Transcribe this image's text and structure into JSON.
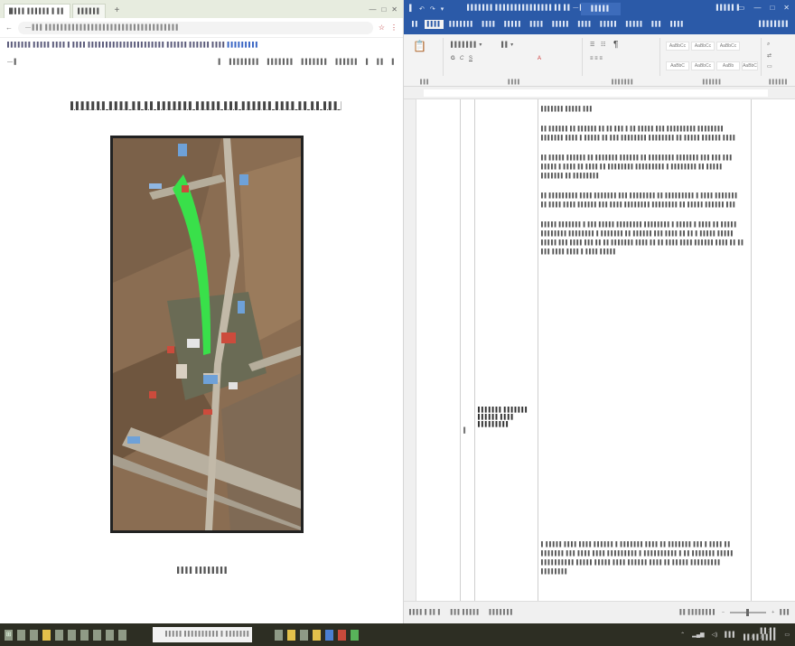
{
  "browser": {
    "tabs": [
      {
        "label": "█ ▌▌▌ ▌▌▌▌▌▌ ▌ ▌▌"
      },
      {
        "label": "▌▌▌▌▌▌"
      }
    ],
    "new_tab": "+",
    "controls": [
      "—",
      "□",
      "✕"
    ],
    "address": "— ▌▌▌ ▌▌▌▌▌▌▌▌▌▌▌▌▌▌▌▌▌▌▌▌▌▌▌▌▌▌▌▌▌▌▌▌▌▌▌",
    "notice": "▌▌▌▌▌▌▌ ▌▌▌▌▌ ▌▌▌▌ ▌ ▌▌▌▌ ▌▌▌▌▌▌▌▌▌▌▌▌▌▌▌▌▌▌▌▌▌▌ ▌▌▌▌▌▌ ▌▌▌▌▌▌ ▌▌▌▌",
    "notice_link": "▌▌▌▌▌▌▌▌▌",
    "pdf_left": "—  ▌",
    "pdf_right": [
      "▌",
      "▌▌▌▌▌▌▌▌",
      "▌▌▌▌▌▌▌",
      "▌▌▌▌▌▌▌",
      "▌▌▌▌▌▌",
      "▌",
      "▌▌",
      "▌"
    ]
  },
  "doc": {
    "caption_top": "▌▌▌▌▌▌▌ ▌▌▌▌ ▌▌ ▌▌ ▌▌▌▌▌▌▌ ▌▌▌▌▌ ▌▌▌ ▌▌▌▌▌▌ ▌▌▌▌ ▌▌ ▌▌ ▌▌▌ ▌▌▌▌ ▌▌▌▌▌▌▌▌",
    "caption_bottom": "▌▌▌▌ ▌▌▌▌▌▌▌▌"
  },
  "word": {
    "qat": [
      "▌",
      "↶",
      "↷",
      "▾"
    ],
    "doc_title": "▌▌▌▌▌▌▌ ▌▌▌▌▌▌▌▌▌▌▌▌▌▌▌ ▌▌ ▌▌  —  ▌▌▌",
    "title_tab": "▌▌▌▌▌",
    "user": "▌▌▌▌▌ ▌",
    "win_controls": [
      "▭",
      "—",
      "□",
      "✕"
    ],
    "ribbon_tabs": [
      "▌▌",
      "▌▌▌▌",
      "▌▌▌▌▌▌▌",
      "▌▌▌▌",
      "▌▌▌▌▌",
      "▌▌▌▌",
      "▌▌▌▌▌",
      "▌▌▌▌",
      "▌▌▌▌▌",
      "▌▌▌▌▌",
      "▌▌▌",
      "▌▌▌▌"
    ],
    "share": "▌▌▌▌▌▌▌▌",
    "ribbon_groups": [
      "▌▌▌",
      "▌▌▌▌",
      "▌▌▌▌▌▌▌",
      "▌▌▌▌▌▌",
      "▌▌▌▌▌▌"
    ],
    "styles": [
      "AaBbCc",
      "AaBbCc",
      "AaBbCc",
      "AaBbC",
      "AaBbCc",
      "AaBb",
      "AaBbC"
    ],
    "table_label": "▌▌▌▌▌▌▌ ▌▌▌▌▌▌▌ ▌▌▌▌▌▌ ▌▌▌▌ ▌▌▌▌▌▌▌▌▌",
    "table_row_marker": "▌",
    "paragraphs": [
      "▌▌▌▌▌▌▌ ▌▌▌▌▌ ▌▌▌",
      "▌▌ ▌▌▌▌▌▌ ▌▌ ▌▌▌▌▌▌ ▌▌ ▌▌ ▌▌▌ ▌ ▌▌ ▌▌▌▌▌ ▌▌▌ ▌▌▌▌▌▌▌▌▌ ▌▌▌▌▌▌▌▌ ▌▌▌▌▌▌▌ ▌▌▌▌ ▌ ▌▌▌▌▌ ▌▌ ▌▌▌ ▌▌▌▌▌▌▌▌ ▌▌▌▌▌▌▌▌ ▌▌ ▌▌▌▌▌ ▌▌▌▌▌▌ ▌▌▌▌",
      "▌▌ ▌▌▌▌▌ ▌▌▌▌▌▌ ▌▌ ▌▌▌▌▌▌▌ ▌▌▌▌▌▌ ▌▌ ▌▌▌▌▌▌▌▌ ▌▌▌▌▌▌▌ ▌▌▌ ▌▌▌ ▌▌▌ ▌▌▌▌▌ ▌ ▌▌▌▌ ▌▌ ▌▌▌▌ ▌▌ ▌▌▌▌▌▌▌▌ ▌▌▌▌▌▌▌▌▌ ▌ ▌▌▌▌▌▌▌▌ ▌▌ ▌▌▌▌▌ ▌▌▌▌▌▌▌ ▌▌ ▌▌▌▌▌▌▌▌",
      "▌▌ ▌▌▌▌▌▌▌▌▌ ▌▌▌▌ ▌▌▌▌▌▌▌ ▌▌▌ ▌▌▌▌▌▌▌▌ ▌▌ ▌▌▌▌▌▌▌▌▌ ▌ ▌▌▌▌ ▌▌▌▌▌▌▌ ▌▌ ▌▌▌▌ ▌▌▌▌ ▌▌▌▌▌▌ ▌▌▌ ▌▌▌▌ ▌▌▌▌▌▌▌▌ ▌▌▌▌▌▌▌▌ ▌▌ ▌▌▌▌▌ ▌▌▌▌▌▌ ▌▌▌",
      "▌▌▌▌▌ ▌▌▌▌▌▌▌ ▌ ▌▌▌ ▌▌▌▌▌ ▌▌▌▌▌▌▌▌ ▌▌▌▌▌▌▌▌ ▌ ▌▌▌▌▌ ▌ ▌▌▌▌ ▌▌ ▌▌▌▌▌ ▌▌▌▌▌▌▌▌ ▌▌▌▌▌▌▌▌ ▌ ▌▌▌▌▌▌▌ ▌▌ ▌▌▌▌▌▌ ▌▌▌ ▌▌▌▌ ▌▌ ▌▌ ▌ ▌▌▌▌▌ ▌▌▌▌▌ ▌▌▌▌▌ ▌▌▌ ▌▌▌▌ ▌▌▌ ▌▌ ▌▌ ▌▌▌▌▌▌▌ ▌▌▌▌ ▌▌ ▌▌ ▌▌▌▌ ▌▌▌▌ ▌▌▌▌▌▌ ▌▌▌▌ ▌▌ ▌▌ ▌▌▌ ▌▌▌▌ ▌▌▌▌ ▌ ▌▌▌▌ ▌▌▌▌▌"
    ],
    "paragraph_bottom": "▌ ▌▌▌▌▌ ▌▌▌▌ ▌▌▌▌ ▌▌▌▌▌▌ ▌ ▌▌▌▌▌▌▌ ▌▌▌▌ ▌▌ ▌▌▌▌▌▌▌ ▌▌▌ ▌ ▌▌▌▌ ▌▌ ▌▌▌▌▌▌▌ ▌▌▌ ▌▌▌▌ ▌▌▌▌ ▌▌▌▌▌▌▌▌▌ ▌ ▌▌▌▌▌▌▌▌▌▌ ▌ ▌▌ ▌▌▌▌▌▌▌ ▌▌▌▌▌ ▌▌▌▌▌▌▌▌▌▌ ▌▌▌▌▌ ▌▌▌▌▌ ▌▌▌▌ ▌▌▌▌▌▌ ▌▌▌▌ ▌▌ ▌▌▌▌▌ ▌▌▌▌▌▌▌▌▌ ▌▌▌▌▌▌▌▌",
    "status_page": "▌▌▌▌ ▌ ▌▌ ▌",
    "status_words": "▌▌▌ ▌▌▌▌▌",
    "status_lang": "▌▌▌▌▌▌▌",
    "status_right": "▌▌ ▌▌▌▌▌▌▌▌",
    "zoom": "▌▌▌"
  },
  "taskbar": {
    "search_placeholder": "▌▌▌▌▌ ▌▌▌▌▌▌▌▌▌▌ ▌ ▌▌▌▌▌▌▌",
    "time": "▌▌:▌▌",
    "date": "▌▌/▌▌/▌▌▌▌",
    "lang": "▌▌▌"
  },
  "colors": {
    "word_blue": "#2b5aa8",
    "taskbar": "#2d2e23",
    "route_green": "#39e04a"
  }
}
